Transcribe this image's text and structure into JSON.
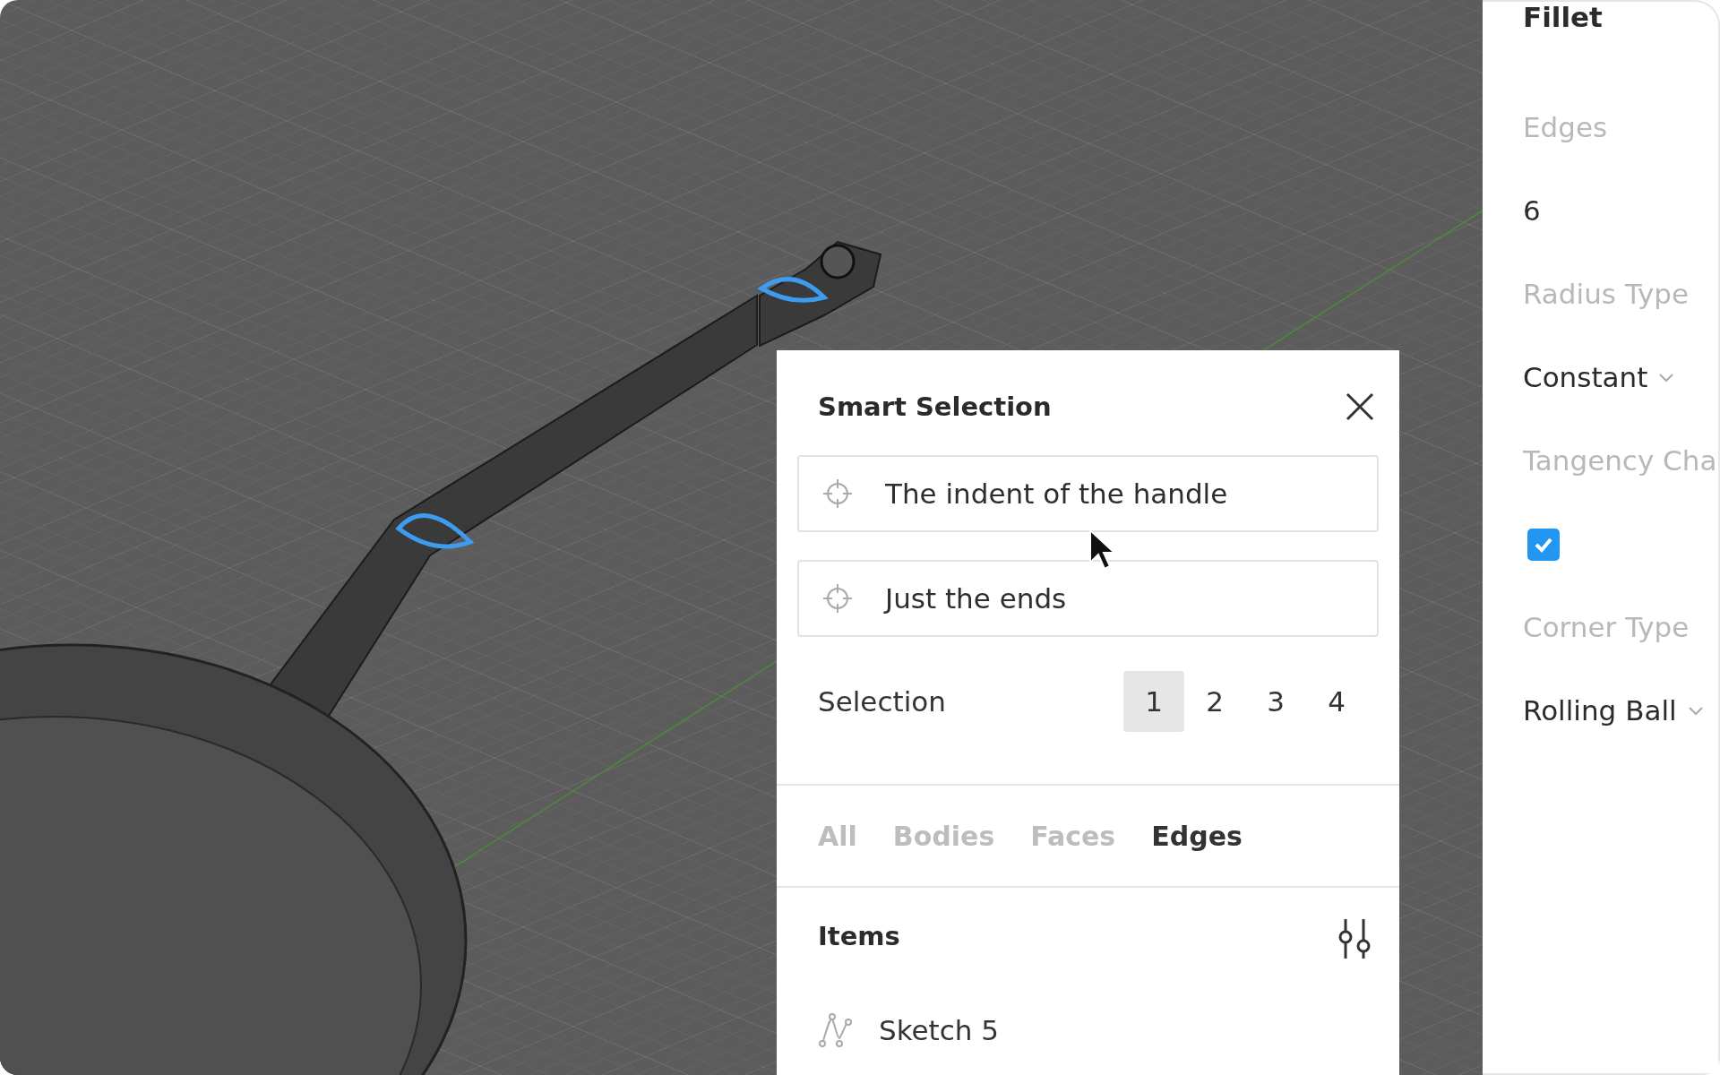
{
  "dialog": {
    "title": "Smart Selection",
    "prompts": [
      {
        "text": "The indent of the handle"
      },
      {
        "text": "Just the ends"
      }
    ],
    "selection": {
      "label": "Selection",
      "options": [
        {
          "label": "1",
          "selected": true
        },
        {
          "label": "2",
          "selected": false
        },
        {
          "label": "3",
          "selected": false
        },
        {
          "label": "4",
          "selected": false
        }
      ]
    },
    "filters": [
      {
        "label": "All",
        "selected": false
      },
      {
        "label": "Bodies",
        "selected": false
      },
      {
        "label": "Faces",
        "selected": false
      },
      {
        "label": "Edges",
        "selected": true
      }
    ],
    "items": {
      "title": "Items",
      "rows": [
        {
          "label": "Sketch 5"
        }
      ]
    }
  },
  "properties": {
    "title": "Fillet",
    "fields": [
      {
        "label": "Edges",
        "kind": "value",
        "value": "6"
      },
      {
        "label": "Radius Type",
        "kind": "dropdown",
        "value": "Constant"
      },
      {
        "label": "Tangency Cha",
        "kind": "checkbox",
        "checked": true
      },
      {
        "label": "Corner Type",
        "kind": "dropdown",
        "value": "Rolling Ball"
      }
    ]
  }
}
